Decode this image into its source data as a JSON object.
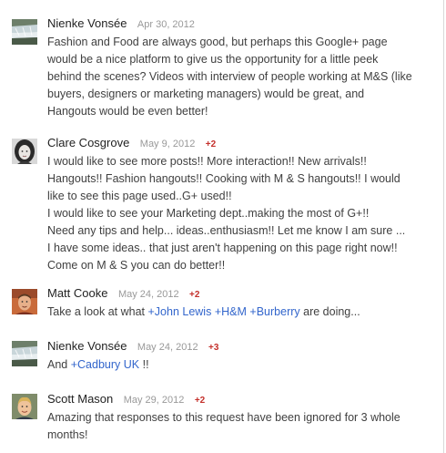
{
  "comments": [
    {
      "author": "Nienke Vonsée",
      "date": "Apr 30, 2012",
      "plus": "",
      "avatar": "waterfall-avatar",
      "lines": [
        "Fashion and Food are always good, but perhaps this Google+ page",
        "would be a nice platform to give us the opportunity for a little peek",
        "behind the scenes? Videos with interview of people working at M&S (like",
        "buyers, designers or marketing managers) would be great, and",
        "Hangouts would be even better!"
      ]
    },
    {
      "author": "Clare Cosgrove",
      "date": "May 9, 2012",
      "plus": "+2",
      "avatar": "woman-portrait-avatar",
      "lines": [
        "I would like to see more posts!! More interaction!! New arrivals!!",
        "Hangouts!! Fashion hangouts!! Cooking with M & S hangouts!! I would",
        "like to see this page used..G+ used!!",
        "I would like to see your Marketing dept..making the most of G+!!",
        "Need any tips and help... ideas..enthusiasm!! Let me know I am sure ...",
        "I have some ideas.. that just aren't happening on this page right now!!",
        "Come on M & S you can do better!!"
      ]
    },
    {
      "author": "Matt Cooke",
      "date": "May 24, 2012",
      "plus": "+2",
      "avatar": "man-portrait-avatar",
      "text_before": "Take a look at what ",
      "mentions": [
        "John Lewis",
        "H&M",
        "Burberry"
      ],
      "text_after": " are doing..."
    },
    {
      "author": "Nienke Vonsée",
      "date": "May 24, 2012",
      "plus": "+3",
      "avatar": "waterfall-avatar",
      "text_before": "And ",
      "mentions": [
        "Cadbury UK"
      ],
      "text_after": " !!"
    },
    {
      "author": "Scott Mason",
      "date": "May 29, 2012",
      "plus": "+2",
      "avatar": "blond-man-avatar",
      "lines": [
        "Amazing that responses to this request have been ignored for 3 whole",
        "months!"
      ]
    }
  ],
  "mention_prefix": "+",
  "colors": {
    "author": "#222222",
    "date": "#999999",
    "plus_one": "#c4302b",
    "mention_link": "#3366cc",
    "body_text": "#404040"
  }
}
